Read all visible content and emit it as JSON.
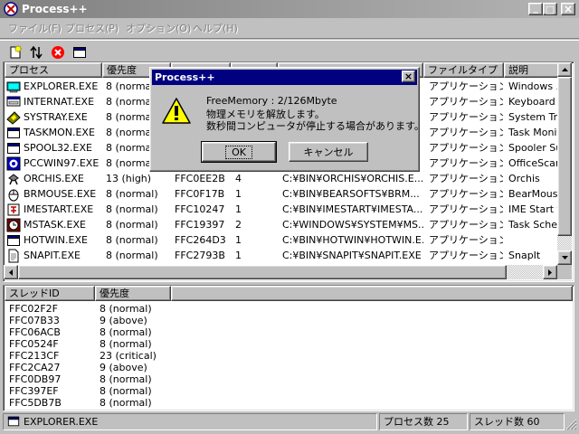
{
  "window": {
    "title": "Process++",
    "minimize_glyph": "_",
    "maximize_glyph": "□",
    "close_glyph": "×"
  },
  "menu": {
    "items": [
      "ファイル(F)",
      "プロセス(P)",
      "オプション(O)",
      "ヘルプ(H)"
    ]
  },
  "toolbar": {
    "icons": [
      "new-process-icon",
      "sort-icon",
      "terminate-icon",
      "window-icon"
    ]
  },
  "process_table": {
    "columns": [
      "プロセス",
      "優先度",
      "",
      "",
      "",
      "ファイルタイプ",
      "説明"
    ],
    "rows": [
      {
        "name": "EXPLORER.EXE",
        "priority": "8 (norma",
        "id": "",
        "threads": "",
        "path": "",
        "type": "アプリケーション",
        "desc": "Windows エ",
        "icon": "explorer-icon"
      },
      {
        "name": "INTERNAT.EXE",
        "priority": "8 (norma",
        "id": "",
        "threads": "",
        "path": "",
        "type": "アプリケーション",
        "desc": "Keyboard L",
        "icon": "keyboard-icon"
      },
      {
        "name": "SYSTRAY.EXE",
        "priority": "8 (norma",
        "id": "",
        "threads": "",
        "path": "",
        "type": "アプリケーション",
        "desc": "System Tra",
        "icon": "systray-icon"
      },
      {
        "name": "TASKMON.EXE",
        "priority": "8 (norma",
        "id": "",
        "threads": "",
        "path": "",
        "type": "アプリケーション",
        "desc": "Task Monit",
        "icon": "window-icon"
      },
      {
        "name": "SPOOL32.EXE",
        "priority": "8 (norma",
        "id": "",
        "threads": "",
        "path": "",
        "type": "アプリケーション",
        "desc": "Spooler Sul",
        "icon": "window-icon"
      },
      {
        "name": "PCCWIN97.EXE",
        "priority": "8 (norma",
        "id": "",
        "threads": "",
        "path": "",
        "type": "アプリケーション",
        "desc": "OfficeScan",
        "icon": "antivirus-icon"
      },
      {
        "name": "ORCHIS.EXE",
        "priority": "13 (high)",
        "id": "FFC0EE2B",
        "threads": "4",
        "path": "C:¥BIN¥ORCHIS¥ORCHIS.E...",
        "type": "アプリケーション",
        "desc": "Orchis",
        "icon": "orchis-icon"
      },
      {
        "name": "BRMOUSE.EXE",
        "priority": "8 (normal)",
        "id": "FFC0F17B",
        "threads": "1",
        "path": "C:¥BIN¥BEARSOFTS¥BRM...",
        "type": "アプリケーション",
        "desc": "BearMouse",
        "icon": "mouse-icon"
      },
      {
        "name": "IMESTART.EXE",
        "priority": "8 (normal)",
        "id": "FFC10247",
        "threads": "1",
        "path": "C:¥BIN¥IMESTART¥IMESTA...",
        "type": "アプリケーション",
        "desc": "IME Start f",
        "icon": "ime-icon"
      },
      {
        "name": "MSTASK.EXE",
        "priority": "8 (normal)",
        "id": "FFC19397",
        "threads": "2",
        "path": "C:¥WINDOWS¥SYSTEM¥MS...",
        "type": "アプリケーション",
        "desc": "Task Sched",
        "icon": "scheduler-icon"
      },
      {
        "name": "HOTWIN.EXE",
        "priority": "8 (normal)",
        "id": "FFC264D3",
        "threads": "1",
        "path": "C:¥BIN¥HOTWIN¥HOTWIN.E...",
        "type": "アプリケーション",
        "desc": "",
        "icon": "window-icon"
      },
      {
        "name": "SNAPIT.EXE",
        "priority": "8 (normal)",
        "id": "FFC2793B",
        "threads": "1",
        "path": "C:¥BIN¥SNAPIT¥SNAPIT.EXE",
        "type": "アプリケーション",
        "desc": "SnapIt",
        "icon": "document-icon"
      }
    ]
  },
  "thread_table": {
    "columns": [
      "スレッドID",
      "優先度"
    ],
    "rows": [
      {
        "id": "FFC02F2F",
        "priority": "8 (normal)"
      },
      {
        "id": "FFC07B33",
        "priority": "9 (above)"
      },
      {
        "id": "FFC06ACB",
        "priority": "8 (normal)"
      },
      {
        "id": "FFC0524F",
        "priority": "8 (normal)"
      },
      {
        "id": "FFC213CF",
        "priority": "23 (critical)"
      },
      {
        "id": "FFC2CA27",
        "priority": "9 (above)"
      },
      {
        "id": "FFC0DB97",
        "priority": "8 (normal)"
      },
      {
        "id": "FFC397EF",
        "priority": "8 (normal)"
      },
      {
        "id": "FFC5DB7B",
        "priority": "8 (normal)"
      }
    ]
  },
  "statusbar": {
    "selected": "EXPLORER.EXE",
    "process_count": "プロセス数 25",
    "thread_count": "スレッド数 60"
  },
  "dialog": {
    "title": "Process++",
    "close_glyph": "×",
    "line1": "FreeMemory : 2/126Mbyte",
    "line2": "物理メモリを解放します。",
    "line3": "数秒間コンピュータが停止する場合があります。",
    "ok_label": "OK",
    "cancel_label": "キャンセル",
    "icon": "warning-icon"
  },
  "colors": {
    "face": "#c0c0c0",
    "dialog_title": "#000080",
    "inactive_title": "#808080",
    "warning": "#ffff00",
    "terminate": "#ff0000"
  }
}
